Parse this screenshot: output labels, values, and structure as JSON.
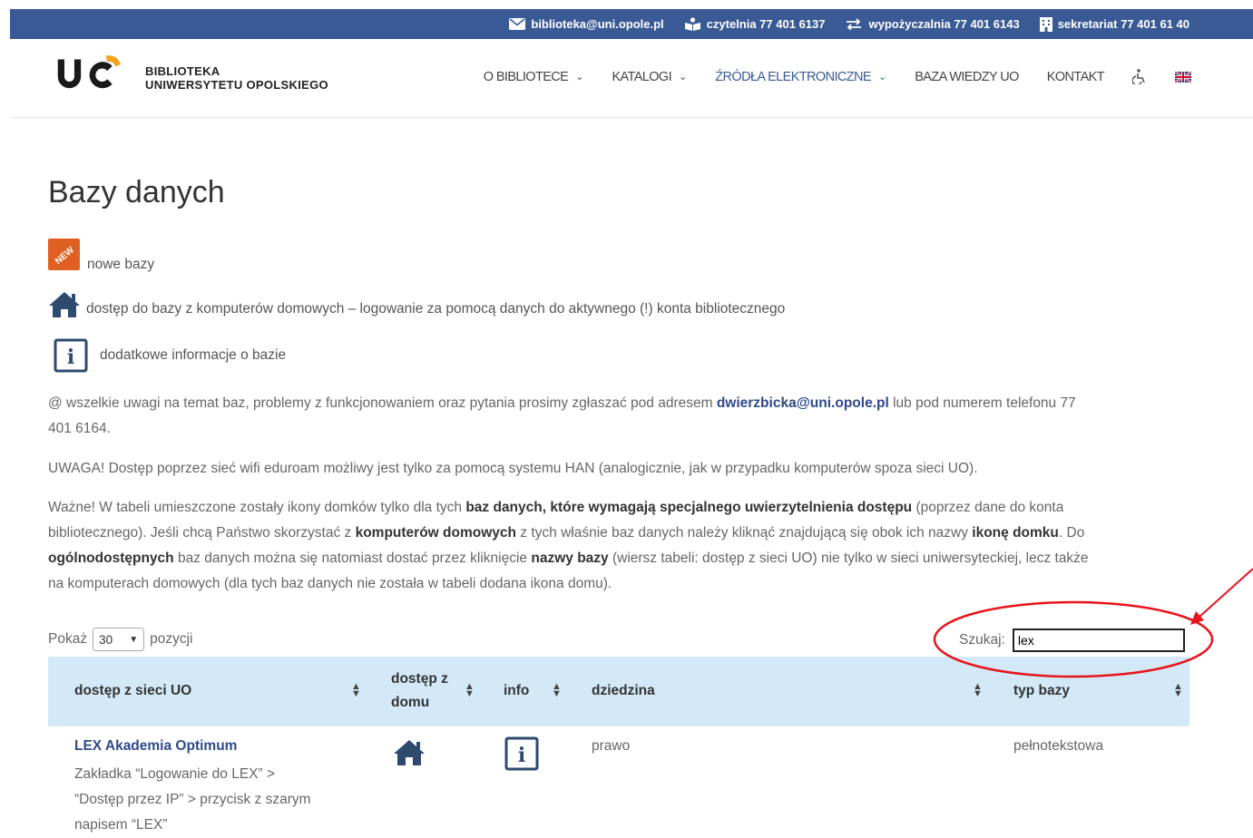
{
  "topbar": {
    "email": "biblioteka@uni.opole.pl",
    "reading_room": "czytelnia 77 401 6137",
    "lending": "wypożyczalnia 77 401 6143",
    "secretariat": "sekretariat 77 401 61 40"
  },
  "logo": {
    "line1": "BIBLIOTEKA",
    "line2": "UNIWERSYTETU OPOLSKIEGO"
  },
  "nav": {
    "items": [
      {
        "label": "O BIBLIOTECE",
        "dropdown": true
      },
      {
        "label": "KATALOGI",
        "dropdown": true
      },
      {
        "label": "ŹRÓDŁA ELEKTRONICZNE",
        "dropdown": true
      },
      {
        "label": "BAZA WIEDZY UO"
      },
      {
        "label": "KONTAKT"
      }
    ]
  },
  "page": {
    "title": "Bazy danych",
    "legend_new": "nowe bazy",
    "legend_home": "dostęp do bazy z komputerów domowych – logowanie za pomocą danych do aktywnego (!) konta bibliotecznego",
    "legend_info": "dodatkowe informacje o bazie",
    "contact_pre": "@ wszelkie uwagi na temat baz, problemy z funkcjonowaniem oraz pytania prosimy zgłaszać pod adresem ",
    "contact_email": "dwierzbicka@uni.opole.pl",
    "contact_mid": " lub pod numerem telefonu 77",
    "contact_end": "401 6164.",
    "warning": "UWAGA! Dostęp poprzez sieć wifi eduroam możliwy jest tylko za pomocą systemu HAN (analogicznie, jak w przypadku komputerów spoza sieci UO).",
    "important_1": "Ważne! W tabeli umieszczone zostały ikony domków tylko dla tych ",
    "important_b1": "baz danych, które wymagają specjalnego uwierzytelnienia dostępu",
    "important_2": " (poprzez dane do konta",
    "important_3": "bibliotecznego). Jeśli chcą Państwo skorzystać z ",
    "important_b2": "komputerów domowych",
    "important_4": " z tych właśnie baz danych należy kliknąć znajdującą się obok ich nazwy ",
    "important_b3": "ikonę domku",
    "important_5": ". Do",
    "important_b4": "ogólnodostępnych",
    "important_6": " baz danych można się natomiast dostać przez kliknięcie ",
    "important_b5": "nazwy bazy",
    "important_7": " (wiersz tabeli: dostęp z sieci UO) nie tylko w sieci uniwersyteckiej, lecz także",
    "important_8": "na komputerach domowych (dla tych baz danych nie została w tabeli dodana ikona domu)."
  },
  "table_controls": {
    "show_label": "Pokaż",
    "show_value": "30",
    "show_suffix": "pozycji",
    "search_label": "Szukaj:",
    "search_value": "lex"
  },
  "table": {
    "headers": [
      "dostęp z sieci UO",
      "dostęp z",
      "domu",
      "info",
      "dziedzina",
      "typ bazy"
    ],
    "rows": [
      {
        "name": "LEX Akademia Optimum",
        "note_1": "Zakładka “Logowanie do LEX” >",
        "note_2": "“Dostęp przez IP” > przycisk z szarym",
        "note_3": "napisem “LEX”",
        "field": "prawo",
        "type": "pełnotekstowa"
      }
    ]
  },
  "icons": {
    "new_badge": "NEW",
    "info_glyph": "i",
    "annotation_color": "#e8141b",
    "brand_color": "#3a5a96"
  }
}
